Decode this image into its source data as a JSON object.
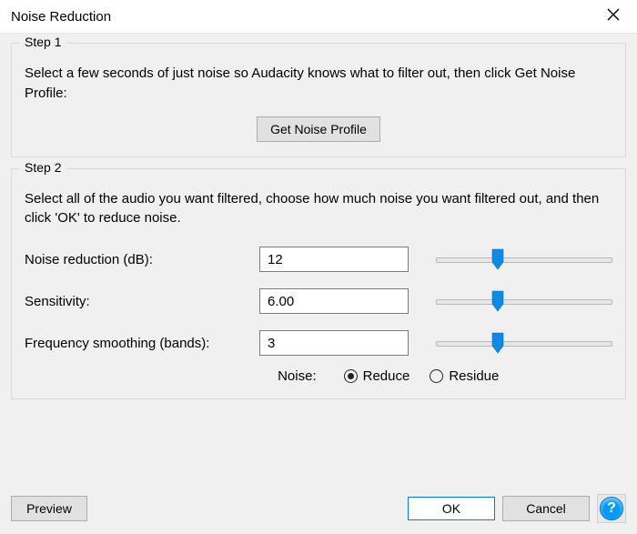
{
  "window": {
    "title": "Noise Reduction"
  },
  "step1": {
    "legend": "Step 1",
    "instruction": "Select a few seconds of just noise so Audacity knows what to filter out, then click Get Noise Profile:",
    "get_profile_label": "Get Noise Profile"
  },
  "step2": {
    "legend": "Step 2",
    "instruction": "Select all of the audio you want filtered, choose how much noise you want filtered out, and then click 'OK' to reduce noise.",
    "noise_reduction": {
      "label": "Noise reduction (dB):",
      "value": "12",
      "slider_pct": 35
    },
    "sensitivity": {
      "label": "Sensitivity:",
      "value": "6.00",
      "slider_pct": 35
    },
    "frequency_smoothing": {
      "label": "Frequency smoothing (bands):",
      "value": "3",
      "slider_pct": 35
    },
    "mode": {
      "label": "Noise:",
      "reduce_label": "Reduce",
      "residue_label": "Residue",
      "selected": "reduce"
    }
  },
  "buttons": {
    "preview": "Preview",
    "ok": "OK",
    "cancel": "Cancel"
  },
  "icons": {
    "help": "?"
  }
}
